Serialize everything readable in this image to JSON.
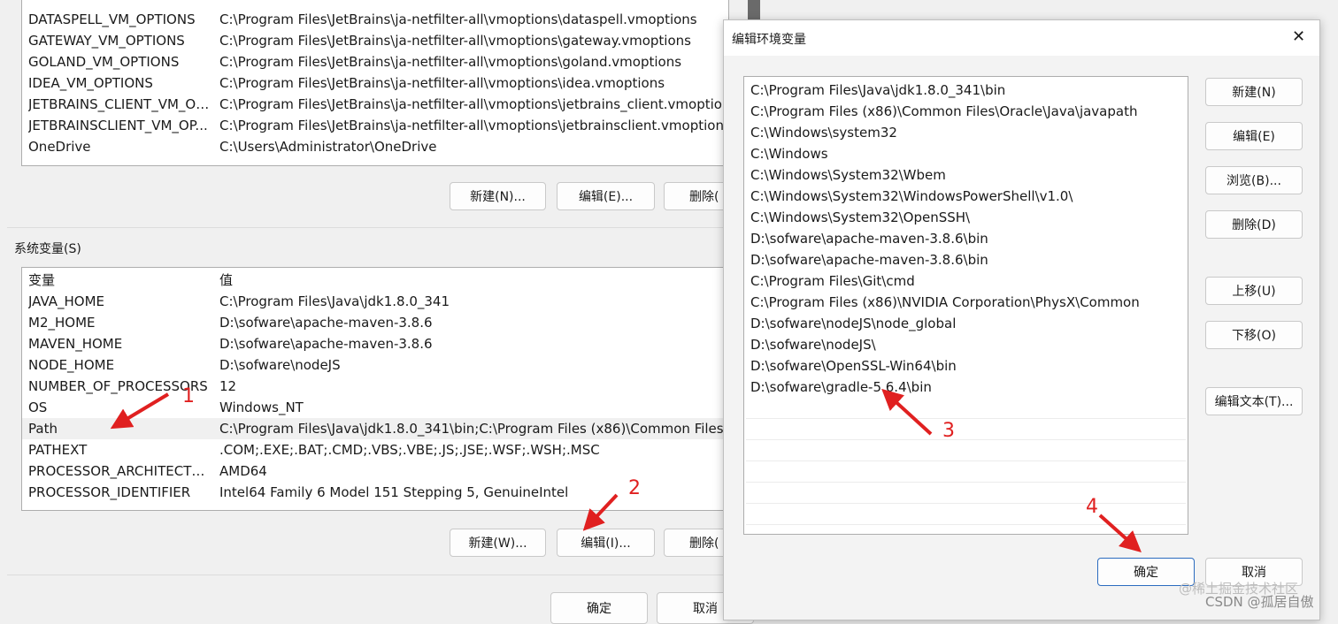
{
  "user_section": {
    "rows": [
      {
        "name": "DATASPELL_VM_OPTIONS",
        "value": "C:\\Program Files\\JetBrains\\ja-netfilter-all\\vmoptions\\dataspell.vmoptions"
      },
      {
        "name": "GATEWAY_VM_OPTIONS",
        "value": "C:\\Program Files\\JetBrains\\ja-netfilter-all\\vmoptions\\gateway.vmoptions"
      },
      {
        "name": "GOLAND_VM_OPTIONS",
        "value": "C:\\Program Files\\JetBrains\\ja-netfilter-all\\vmoptions\\goland.vmoptions"
      },
      {
        "name": "IDEA_VM_OPTIONS",
        "value": "C:\\Program Files\\JetBrains\\ja-netfilter-all\\vmoptions\\idea.vmoptions"
      },
      {
        "name": "JETBRAINS_CLIENT_VM_OP...",
        "value": "C:\\Program Files\\JetBrains\\ja-netfilter-all\\vmoptions\\jetbrains_client.vmoptions"
      },
      {
        "name": "JETBRAINSCLIENT_VM_OP...",
        "value": "C:\\Program Files\\JetBrains\\ja-netfilter-all\\vmoptions\\jetbrainsclient.vmoptions"
      },
      {
        "name": "OneDrive",
        "value": "C:\\Users\\Administrator\\OneDrive"
      }
    ],
    "buttons": {
      "new": "新建(N)...",
      "edit": "编辑(E)...",
      "delete": "删除("
    }
  },
  "system_section": {
    "title": "系统变量(S)",
    "header": {
      "col1": "变量",
      "col2": "值"
    },
    "rows": [
      {
        "name": "JAVA_HOME",
        "value": "C:\\Program Files\\Java\\jdk1.8.0_341"
      },
      {
        "name": "M2_HOME",
        "value": "D:\\sofware\\apache-maven-3.8.6"
      },
      {
        "name": "MAVEN_HOME",
        "value": "D:\\sofware\\apache-maven-3.8.6"
      },
      {
        "name": "NODE_HOME",
        "value": "D:\\sofware\\nodeJS"
      },
      {
        "name": "NUMBER_OF_PROCESSORS",
        "value": "12"
      },
      {
        "name": "OS",
        "value": "Windows_NT"
      },
      {
        "name": "Path",
        "value": "C:\\Program Files\\Java\\jdk1.8.0_341\\bin;C:\\Program Files (x86)\\Common Files\\O"
      },
      {
        "name": "PATHEXT",
        "value": ".COM;.EXE;.BAT;.CMD;.VBS;.VBE;.JS;.JSE;.WSF;.WSH;.MSC"
      },
      {
        "name": "PROCESSOR_ARCHITECTURE",
        "value": "AMD64"
      },
      {
        "name": "PROCESSOR_IDENTIFIER",
        "value": "Intel64 Family 6 Model 151 Stepping 5, GenuineIntel"
      }
    ],
    "buttons": {
      "new": "新建(W)...",
      "edit": "编辑(I)...",
      "delete": "删除("
    }
  },
  "main_footer": {
    "ok": "确定",
    "cancel": "取消"
  },
  "dialog": {
    "title": "编辑环境变量",
    "close": "✕",
    "entries": [
      "C:\\Program Files\\Java\\jdk1.8.0_341\\bin",
      "C:\\Program Files (x86)\\Common Files\\Oracle\\Java\\javapath",
      "C:\\Windows\\system32",
      "C:\\Windows",
      "C:\\Windows\\System32\\Wbem",
      "C:\\Windows\\System32\\WindowsPowerShell\\v1.0\\",
      "C:\\Windows\\System32\\OpenSSH\\",
      "D:\\sofware\\apache-maven-3.8.6\\bin",
      "D:\\sofware\\apache-maven-3.8.6\\bin",
      "C:\\Program Files\\Git\\cmd",
      "C:\\Program Files (x86)\\NVIDIA Corporation\\PhysX\\Common",
      "D:\\sofware\\nodeJS\\node_global",
      "D:\\sofware\\nodeJS\\",
      "D:\\sofware\\OpenSSL-Win64\\bin",
      "D:\\sofware\\gradle-5.6.4\\bin"
    ],
    "buttons": {
      "new": "新建(N)",
      "edit": "编辑(E)",
      "browse": "浏览(B)...",
      "delete": "删除(D)",
      "up": "上移(U)",
      "down": "下移(O)",
      "edit_text": "编辑文本(T)...",
      "ok": "确定",
      "cancel": "取消"
    }
  },
  "annotations": [
    "1",
    "2",
    "3",
    "4"
  ],
  "watermark": {
    "line1": "@稀土掘金技术社区",
    "line2": "CSDN @孤居自傲"
  },
  "colors": {
    "arrow": "#e02020",
    "selected_row": "#f0f0f0",
    "ok_border": "#2b6bbf"
  }
}
